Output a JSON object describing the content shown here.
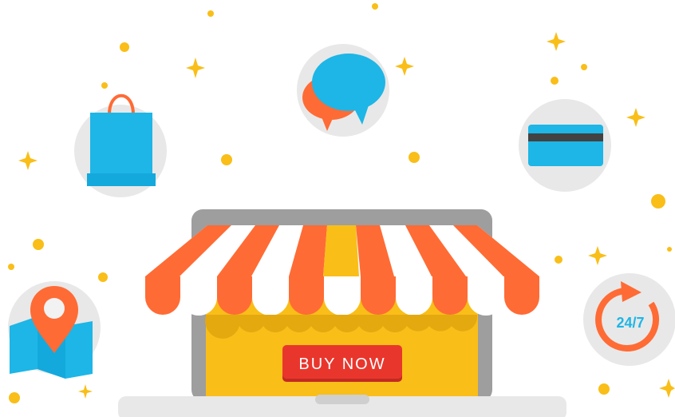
{
  "cta": {
    "buy_now_label": "BUY NOW"
  },
  "clock": {
    "label": "24/7"
  },
  "colors": {
    "accent_orange": "#FF6B35",
    "sky_blue": "#1DB6E6",
    "yellow": "#F9BE18",
    "cta_red": "#E9362D",
    "gray_circle": "#E8E8E8",
    "laptop_gray": "#9E9E9E"
  },
  "icons": [
    "shopping-bag-icon",
    "chat-bubbles-icon",
    "credit-card-icon",
    "map-pin-icon",
    "clock-24-7-icon",
    "sparkle-icon"
  ]
}
